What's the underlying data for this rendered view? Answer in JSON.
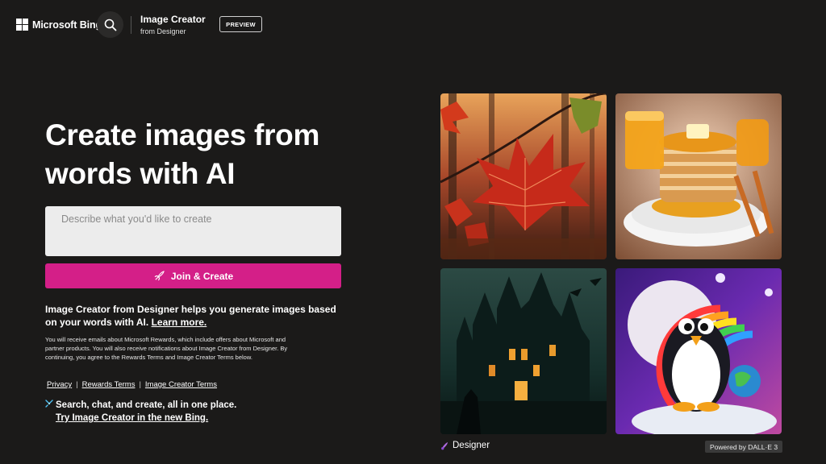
{
  "header": {
    "logo_text": "Microsoft Bing",
    "app_title": "Image Creator",
    "app_subtitle": "from Designer",
    "preview_label": "PREVIEW"
  },
  "hero": {
    "title": "Create images from words with AI"
  },
  "prompt": {
    "placeholder": "Describe what you'd like to create",
    "value": ""
  },
  "join_button": {
    "label": "Join & Create"
  },
  "description": {
    "text": "Image Creator from Designer helps you generate images based on your words with AI.",
    "learn_more": "Learn more."
  },
  "fine_print": "You will receive emails about Microsoft Rewards, which include offers about Microsoft and partner products. You will also receive notifications about Image Creator from Designer. By continuing, you agree to the Rewards Terms and Image Creator Terms below.",
  "footer_links": [
    "Privacy",
    "Rewards Terms",
    "Image Creator Terms"
  ],
  "promo": {
    "text": "Search, chat, and create, all in one place.",
    "link": "Try Image Creator in the new Bing."
  },
  "gallery": {
    "images": [
      {
        "subject": "autumn maple leaf"
      },
      {
        "subject": "pancake stack with orange juice"
      },
      {
        "subject": "gothic haunted castle"
      },
      {
        "subject": "penguin with rainbow"
      }
    ],
    "brand": "Designer",
    "powered_by": "Powered by DALL·E 3"
  },
  "colors": {
    "background": "#1b1a19",
    "accent": "#d41f88",
    "input_bg": "#ececec"
  }
}
